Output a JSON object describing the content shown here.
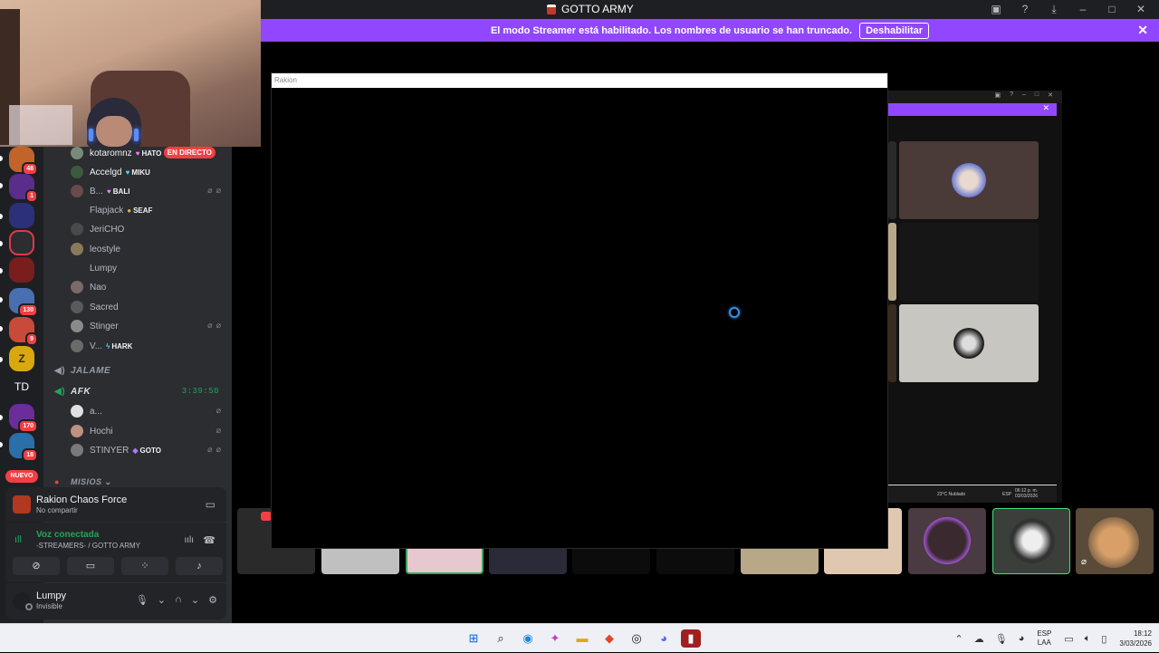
{
  "window": {
    "title": "GOTTO ARMY"
  },
  "banner": {
    "message": "El modo Streamer está habilitado. Los nombres de usuario se han truncado.",
    "button": "Deshabilitar"
  },
  "servers": {
    "badges": [
      "48",
      "1",
      "130",
      "9",
      "170",
      "18"
    ],
    "td_label": "TD",
    "new_label": "NUEVO"
  },
  "members_top": [
    {
      "name": "kotaromnz",
      "tag": "HATO",
      "tag_icon": "pink-heart-icon",
      "live": "EN DIRECTO"
    },
    {
      "name": "Accelgd",
      "tag": "MIKU",
      "tag_icon": "blue-heart-icon"
    },
    {
      "name": "B...",
      "tag": "BALI",
      "tag_icon": "pink-heart-icon"
    },
    {
      "name": "Flapjack",
      "tag": "SEAF",
      "tag_icon": "angry-emoji-icon"
    },
    {
      "name": "JeriCHO",
      "tag": ""
    },
    {
      "name": "leostyle",
      "tag": ""
    },
    {
      "name": "Lumpy",
      "tag": ""
    },
    {
      "name": "Nao",
      "tag": ""
    },
    {
      "name": "Sacred",
      "tag": ""
    },
    {
      "name": "Stinger",
      "tag": ""
    },
    {
      "name": "V...",
      "tag": "HARK",
      "tag_icon": "lightning-icon"
    }
  ],
  "voice_channels": [
    {
      "name": "JALAME"
    },
    {
      "name": "AFK",
      "time": "3:39:50"
    }
  ],
  "members_afk": [
    {
      "name": "a...",
      "tag": ""
    },
    {
      "name": "Hochi",
      "tag": ""
    },
    {
      "name": "STINYER",
      "tag": "GOTO"
    }
  ],
  "category": {
    "name": "MISIOS"
  },
  "activity": {
    "game": "Rakion Chaos Force",
    "status": "No compartir"
  },
  "voice": {
    "status": "Voz conectada",
    "channel": "-STREAMERS- / GOTTO ARMY"
  },
  "user": {
    "name": "Lumpy",
    "status": "Invisible"
  },
  "game_window": {
    "title": "Rakion"
  },
  "mini_taskbar": {
    "weather": "23°C Nublado",
    "lang": "ESP",
    "time": "06:12 p. m.",
    "date": "03/03/2026"
  },
  "taskbar": {
    "lang_top": "ESP",
    "lang_bottom": "LAA",
    "time": "18:12",
    "date": "3/03/2026"
  },
  "colors": {
    "accent": "#9147ff",
    "danger": "#f23f43",
    "online": "#23a55a"
  }
}
